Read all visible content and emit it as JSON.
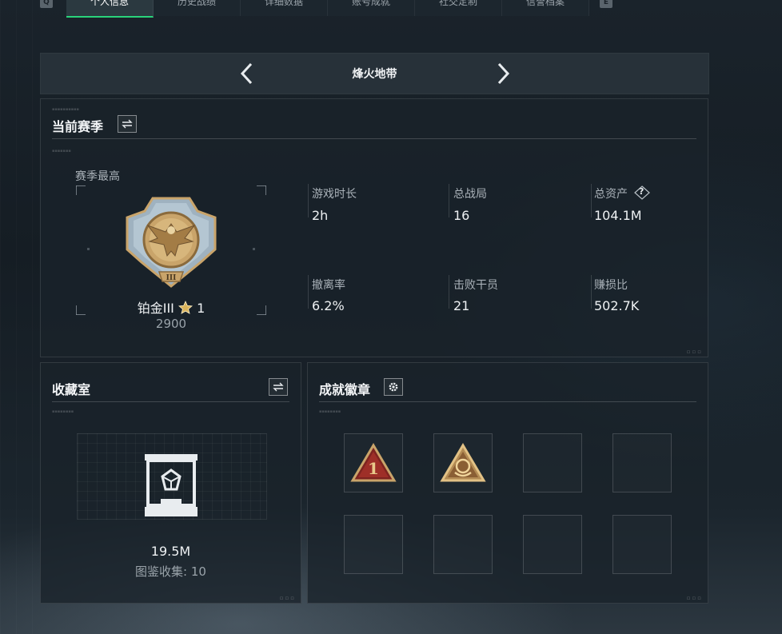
{
  "top_tabs": [
    {
      "label": "个人信息",
      "active": true
    },
    {
      "label": "历史战绩",
      "active": false
    },
    {
      "label": "详细数据",
      "active": false
    },
    {
      "label": "账号成就",
      "active": false
    },
    {
      "label": "社交定制",
      "active": false
    },
    {
      "label": "信誉档案",
      "active": false
    }
  ],
  "key_hints": {
    "left": "Q",
    "right": "E"
  },
  "mode_header": {
    "title": "烽火地带"
  },
  "season": {
    "title": "当前赛季",
    "best_label": "赛季最高",
    "rank_name": "铂金III",
    "rank_stars": "1",
    "rank_points": "2900",
    "stats": {
      "playtime": {
        "label": "游戏时长",
        "value": "2h"
      },
      "total_matches": {
        "label": "总战局",
        "value": "16"
      },
      "total_assets": {
        "label": "总资产",
        "value": "104.1M",
        "help": "?"
      },
      "extract_rate": {
        "label": "撤离率",
        "value": "6.2%"
      },
      "kills": {
        "label": "击败干员",
        "value": "21"
      },
      "profit_ratio": {
        "label": "赚损比",
        "value": "502.7K"
      }
    }
  },
  "collection": {
    "title": "收藏室",
    "value": "19.5M",
    "catalog_label": "图鉴收集:",
    "catalog_count": "10"
  },
  "achievements": {
    "title": "成就徽章",
    "badges": [
      {
        "icon": "rank-one-triangle-icon",
        "filled": true
      },
      {
        "icon": "crown-triangle-icon",
        "filled": true
      },
      {
        "filled": false
      },
      {
        "filled": false
      },
      {
        "filled": false
      },
      {
        "filled": false
      },
      {
        "filled": false
      },
      {
        "filled": false
      }
    ]
  },
  "colors": {
    "accent": "#29d37a",
    "medal_gold": "#c9a46a",
    "medal_silver": "#a8b8c4"
  }
}
